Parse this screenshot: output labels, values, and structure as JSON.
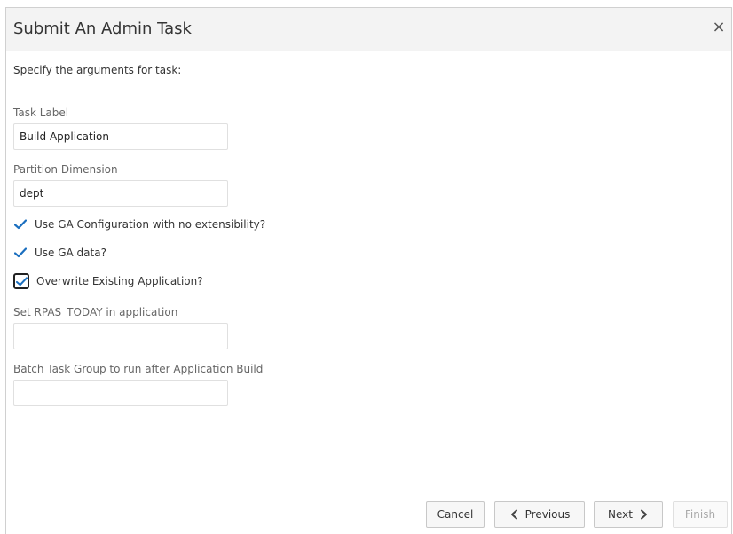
{
  "dialog": {
    "title": "Submit An Admin Task",
    "close_symbol": "×"
  },
  "form": {
    "intro": "Specify the arguments for task:",
    "task_label": {
      "label": "Task Label",
      "value": "Build Application"
    },
    "partition_dimension": {
      "label": "Partition Dimension",
      "value": "dept"
    },
    "checkboxes": [
      {
        "label": "Use GA Configuration with no extensibility?",
        "checked": true
      },
      {
        "label": "Use GA data?",
        "checked": true
      },
      {
        "label": "Overwrite Existing Application?",
        "checked": true
      }
    ],
    "rpas_today": {
      "label": "Set RPAS_TODAY in application",
      "value": ""
    },
    "batch_group": {
      "label": "Batch Task Group to run after Application Build",
      "value": ""
    }
  },
  "footer": {
    "cancel_label": "Cancel",
    "previous_label": "Previous",
    "next_label": "Next",
    "finish_label": "Finish"
  },
  "colors": {
    "checkmark": "#1b6fbf",
    "header_bg": "#f3f3f3"
  },
  "icons": {
    "close": "close-icon",
    "check": "checkmark-icon",
    "previous": "chevron-left-icon",
    "next": "chevron-right-icon"
  }
}
